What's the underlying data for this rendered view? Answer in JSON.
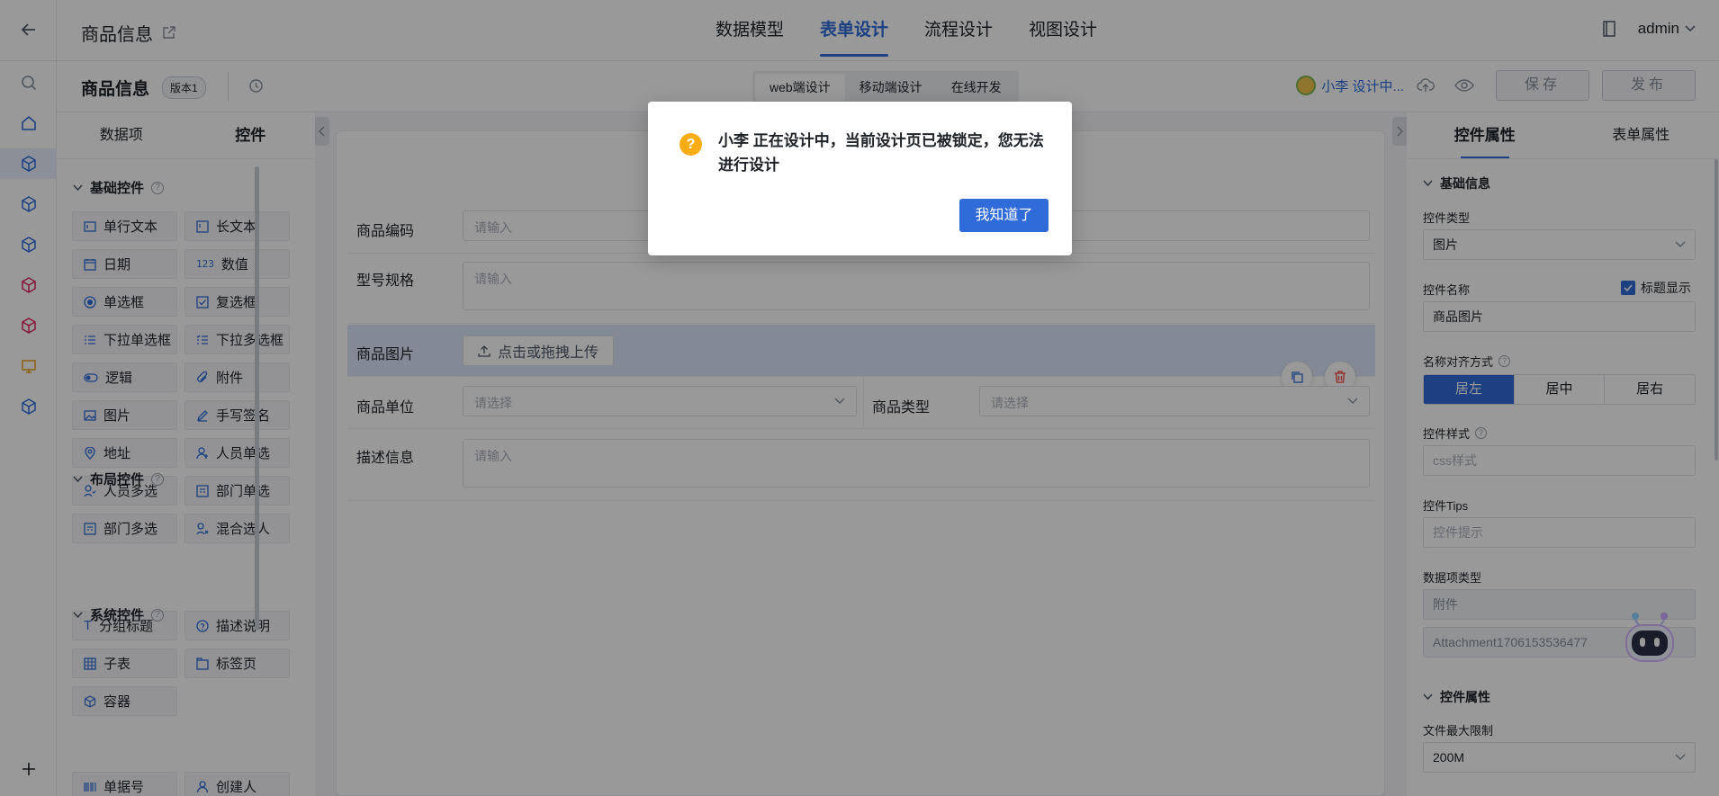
{
  "header": {
    "app_title": "商品信息",
    "tabs": [
      "数据模型",
      "表单设计",
      "流程设计",
      "视图设计"
    ],
    "active_tab": "表单设计",
    "user": "admin"
  },
  "subheader": {
    "form_title": "商品信息",
    "version": "版本1",
    "modes": [
      "web端设计",
      "移动端设计",
      "在线开发"
    ],
    "active_mode": "web端设计",
    "editor_status": "小李 设计中...",
    "save_label": "保存",
    "publish_label": "发布"
  },
  "left_panel": {
    "tabs": [
      "数据项",
      "控件"
    ],
    "active_tab": "控件",
    "groups": [
      {
        "title": "基础控件",
        "items": [
          "单行文本",
          "长文本",
          "日期",
          "数值",
          "单选框",
          "复选框",
          "下拉单选框",
          "下拉多选框",
          "逻辑",
          "附件",
          "图片",
          "手写签名",
          "地址",
          "人员单选",
          "人员多选",
          "部门单选",
          "部门多选",
          "混合选人"
        ]
      },
      {
        "title": "布局控件",
        "items": [
          "分组标题",
          "描述说明",
          "子表",
          "标签页",
          "容器"
        ]
      },
      {
        "title": "系统控件",
        "items": [
          "单据号",
          "创建人"
        ]
      }
    ]
  },
  "form": {
    "fields": [
      {
        "label": "商品编码",
        "placeholder": "请输入"
      },
      {
        "label": "型号规格",
        "placeholder": "请输入"
      },
      {
        "label": "商品图片",
        "upload_label": "点击或拖拽上传"
      },
      {
        "label": "商品单位",
        "placeholder": "请选择"
      },
      {
        "label": "商品类型",
        "placeholder": "请选择"
      },
      {
        "label": "描述信息",
        "placeholder": "请输入"
      }
    ]
  },
  "right_panel": {
    "tabs": [
      "控件属性",
      "表单属性"
    ],
    "active_tab": "控件属性",
    "basic_section": "基础信息",
    "control_type_label": "控件类型",
    "control_type_value": "图片",
    "control_name_label": "控件名称",
    "show_title_label": "标题显示",
    "control_name_value": "商品图片",
    "align_label": "名称对齐方式",
    "align_options": [
      "居左",
      "居中",
      "居右"
    ],
    "align_active": "居左",
    "style_label": "控件样式",
    "style_placeholder": "css样式",
    "tips_label": "控件Tips",
    "tips_placeholder": "控件提示",
    "data_type_label": "数据项类型",
    "data_type_value": "附件",
    "data_code_value": "Attachment1706153536477",
    "prop_section": "控件属性",
    "max_size_label": "文件最大限制",
    "max_size_value": "200M"
  },
  "dialog": {
    "message": "小李 正在设计中，当前设计页已被锁定，您无法进行设计",
    "confirm_label": "我知道了"
  },
  "colors": {
    "primary": "#2f6bd9",
    "warning": "#faad14",
    "danger": "#f53f3f"
  }
}
